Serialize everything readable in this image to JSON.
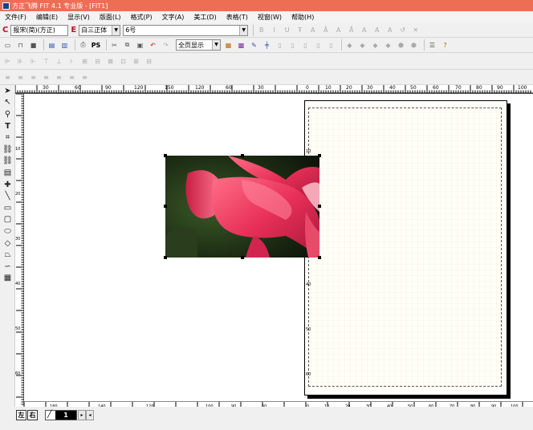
{
  "window": {
    "title": "方正飞腾 FIT 4.1 专业版 - [FIT1]"
  },
  "menu": [
    {
      "label": "文件(F)"
    },
    {
      "label": "编辑(E)"
    },
    {
      "label": "显示(V)"
    },
    {
      "label": "版面(L)"
    },
    {
      "label": "格式(P)"
    },
    {
      "label": "文字(A)"
    },
    {
      "label": "美工(D)"
    },
    {
      "label": "表格(T)"
    },
    {
      "label": "视窗(W)"
    },
    {
      "label": "帮助(H)"
    }
  ],
  "font_bar": {
    "c_letter": "C",
    "chinese_font": "报宋(简)(方正)",
    "e_letter": "E",
    "english_font": "白三正体",
    "font_size": "6号"
  },
  "standard_bar": {
    "ps_label": "PS",
    "zoom": "全页显示"
  },
  "rulers": {
    "top": [
      "30",
      "30",
      "60",
      "90",
      "120",
      "150",
      "120",
      "60",
      "30",
      "0",
      "10",
      "20",
      "30",
      "40",
      "50",
      "60",
      "70",
      "80",
      "90",
      "100"
    ],
    "left": [
      "10",
      "20",
      "30",
      "40",
      "50",
      "60"
    ],
    "bottom": [
      "180",
      "140",
      "120",
      "100",
      "90",
      "60",
      "0",
      "10",
      "20",
      "30",
      "40",
      "50",
      "60",
      "70",
      "80",
      "90",
      "100"
    ]
  },
  "status": {
    "left_btn": "左",
    "right_btn": "右",
    "page_number": "1"
  }
}
